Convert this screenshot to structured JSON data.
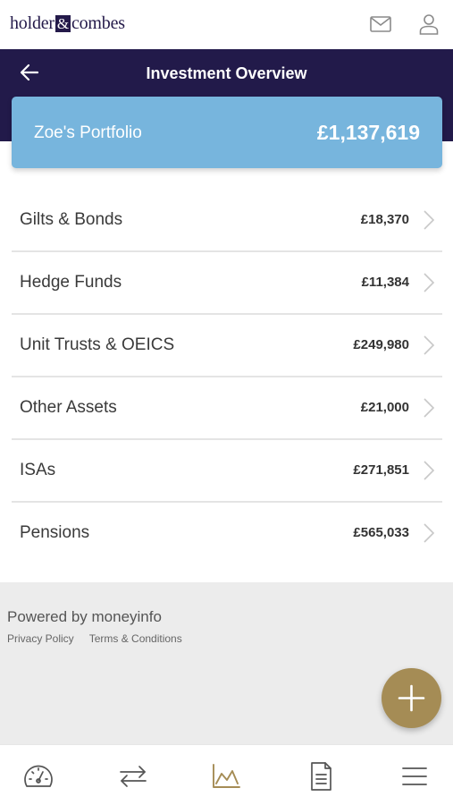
{
  "brand": {
    "logo_left": "holder",
    "logo_amp": "&",
    "logo_right": "combes"
  },
  "header": {
    "title": "Investment Overview"
  },
  "portfolio": {
    "name": "Zoe's Portfolio",
    "value": "£1,137,619"
  },
  "investments": [
    {
      "label": "Gilts & Bonds",
      "amount": "£18,370"
    },
    {
      "label": "Hedge Funds",
      "amount": "£11,384"
    },
    {
      "label": "Unit Trusts & OEICS",
      "amount": "£249,980"
    },
    {
      "label": "Other Assets",
      "amount": "£21,000"
    },
    {
      "label": "ISAs",
      "amount": "£271,851"
    },
    {
      "label": "Pensions",
      "amount": "£565,033"
    }
  ],
  "footer": {
    "powered": "Powered by moneyinfo",
    "privacy": "Privacy Policy",
    "terms": "Terms & Conditions"
  },
  "icons": {
    "top": [
      "mail-icon",
      "user-icon"
    ],
    "nav": [
      "dashboard-gauge-icon",
      "transfer-arrows-icon",
      "chart-icon",
      "document-icon",
      "menu-icon"
    ],
    "fab": "plus-icon"
  },
  "colors": {
    "brand_navy": "#221a4a",
    "portfolio_blue": "#77b5dd",
    "accent_gold": "#a58c55"
  }
}
